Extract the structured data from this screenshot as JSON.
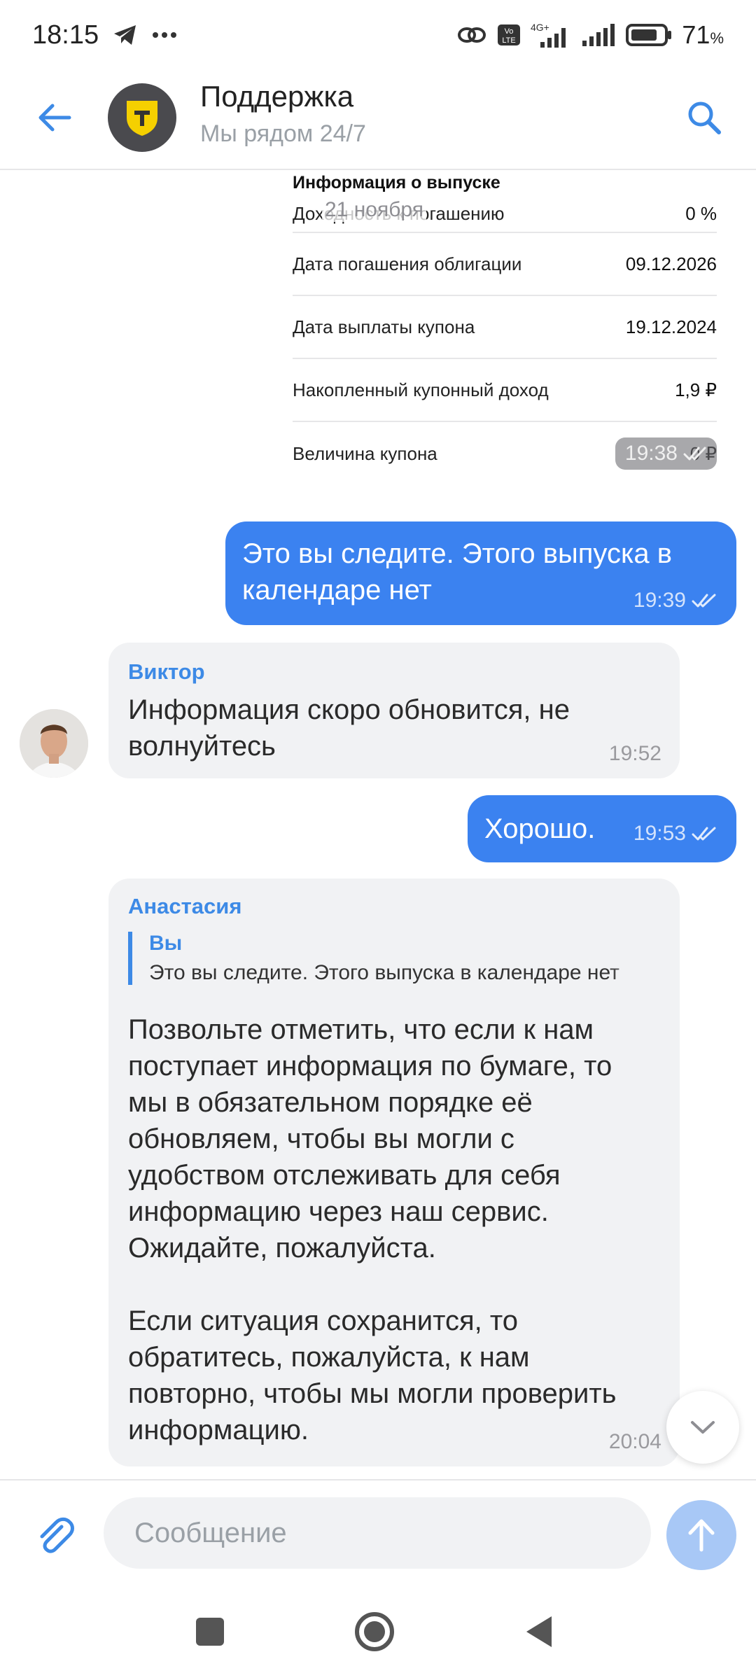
{
  "status_bar": {
    "time": "18:15",
    "network": "4G+",
    "battery_percent": "71",
    "battery_unit": "%"
  },
  "header": {
    "title": "Поддержка",
    "subtitle": "Мы рядом 24/7"
  },
  "info_card": {
    "title": "Информация о выпуске",
    "date_chip": "21 ноября",
    "rows": [
      {
        "label": "Доходность к погашению",
        "value": "0 %"
      },
      {
        "label": "Дата погашения облигации",
        "value": "09.12.2026"
      },
      {
        "label": "Дата выплаты купона",
        "value": "19.12.2024"
      },
      {
        "label": "Накопленный купонный доход",
        "value": "1,9 ₽"
      },
      {
        "label": "Величина купона",
        "value": "0 ₽"
      }
    ],
    "time": "19:38"
  },
  "messages": [
    {
      "text": "Это вы следите. Этого выпуска в календаре нет",
      "time": "19:39"
    },
    {
      "sender": "Виктор",
      "text": "Информация скоро обновится, не волнуйтесь",
      "time": "19:52"
    },
    {
      "text": "Хорошо.",
      "time": "19:53"
    },
    {
      "sender": "Анастасия",
      "reply_to_name": "Вы",
      "reply_to_text": "Это вы следите. Этого выпуска в календаре нет",
      "paragraph_1": "Позвольте отметить, что если к нам поступает информация по бумаге, то мы в обязательном порядке её обновляем, чтобы вы могли с удобством отслеживать для себя информацию через наш сервис. Ожидайте, пожалуйста.",
      "paragraph_2": "Если ситуация сохранится, то обратитесь, пожалуйста, к нам повторно, чтобы мы могли проверить информацию.",
      "time": "20:04"
    }
  ],
  "composer": {
    "placeholder": "Сообщение"
  },
  "colors": {
    "accent": "#3b82f0",
    "incoming_bubble": "#f1f2f4",
    "sender_name": "#3d8ae6",
    "logo_yellow": "#f5d000"
  }
}
